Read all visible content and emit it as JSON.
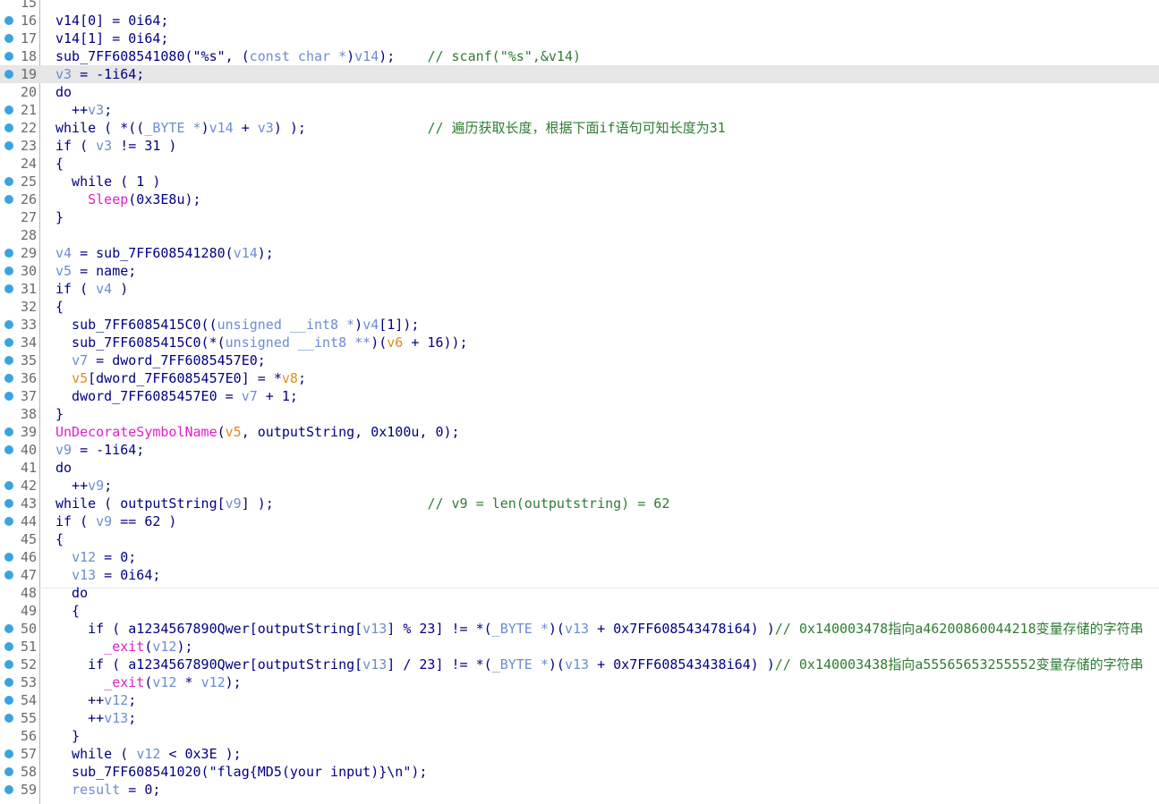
{
  "colors": {
    "default": "#000080",
    "variable": "#6b8dd1",
    "argument": "#e08a1e",
    "comment": "#2e7d32",
    "import": "#e020c8",
    "line_number": "#6a6a6a",
    "breakpoint": "#3aa3e3",
    "highlight": "#e6e6e6"
  },
  "editor": {
    "lines": [
      {
        "n": "15",
        "bp": false,
        "hl": false,
        "tokens": []
      },
      {
        "n": "16",
        "bp": true,
        "hl": false,
        "tokens": [
          [
            "d",
            "v14[0] = 0i64;"
          ]
        ]
      },
      {
        "n": "17",
        "bp": true,
        "hl": false,
        "tokens": [
          [
            "d",
            "v14[1] = 0i64;"
          ]
        ]
      },
      {
        "n": "18",
        "bp": true,
        "hl": false,
        "tokens": [
          [
            "d",
            "sub_7FF608541080(\"%s\", ("
          ],
          [
            "v",
            "const char *"
          ],
          [
            "d",
            ")"
          ],
          [
            "v",
            "v14"
          ],
          [
            "d",
            ");    "
          ],
          [
            "c",
            "// scanf(\"%s\",&v14)"
          ]
        ]
      },
      {
        "n": "19",
        "bp": true,
        "hl": true,
        "tokens": [
          [
            "v",
            "v3"
          ],
          [
            "d",
            " = -1i64;"
          ]
        ]
      },
      {
        "n": "20",
        "bp": false,
        "hl": false,
        "tokens": [
          [
            "d",
            "do"
          ]
        ]
      },
      {
        "n": "21",
        "bp": true,
        "hl": false,
        "tokens": [
          [
            "d",
            "  ++"
          ],
          [
            "v",
            "v3"
          ],
          [
            "d",
            ";"
          ]
        ]
      },
      {
        "n": "22",
        "bp": true,
        "hl": false,
        "tokens": [
          [
            "d",
            "while ( *(("
          ],
          [
            "v",
            "_BYTE *"
          ],
          [
            "d",
            ")"
          ],
          [
            "v",
            "v14"
          ],
          [
            "d",
            " + "
          ],
          [
            "v",
            "v3"
          ],
          [
            "d",
            ") );               "
          ],
          [
            "c",
            "// 遍历获取长度，根据下面if语句可知长度为31"
          ]
        ]
      },
      {
        "n": "23",
        "bp": true,
        "hl": false,
        "tokens": [
          [
            "d",
            "if ( "
          ],
          [
            "v",
            "v3"
          ],
          [
            "d",
            " != 31 )"
          ]
        ]
      },
      {
        "n": "24",
        "bp": false,
        "hl": false,
        "tokens": [
          [
            "d",
            "{"
          ]
        ]
      },
      {
        "n": "25",
        "bp": true,
        "hl": false,
        "tokens": [
          [
            "d",
            "  while ( 1 )"
          ]
        ]
      },
      {
        "n": "26",
        "bp": true,
        "hl": false,
        "tokens": [
          [
            "d",
            "    "
          ],
          [
            "f",
            "Sleep"
          ],
          [
            "d",
            "(0x3E8u);"
          ]
        ]
      },
      {
        "n": "27",
        "bp": false,
        "hl": false,
        "tokens": [
          [
            "d",
            "}"
          ]
        ]
      },
      {
        "n": "28",
        "bp": false,
        "hl": false,
        "tokens": []
      },
      {
        "n": "29",
        "bp": true,
        "hl": false,
        "tokens": [
          [
            "v",
            "v4"
          ],
          [
            "d",
            " = sub_7FF608541280("
          ],
          [
            "v",
            "v14"
          ],
          [
            "d",
            ");"
          ]
        ]
      },
      {
        "n": "30",
        "bp": true,
        "hl": false,
        "tokens": [
          [
            "v",
            "v5"
          ],
          [
            "d",
            " = name;"
          ]
        ]
      },
      {
        "n": "31",
        "bp": true,
        "hl": false,
        "tokens": [
          [
            "d",
            "if ( "
          ],
          [
            "v",
            "v4"
          ],
          [
            "d",
            " )"
          ]
        ]
      },
      {
        "n": "32",
        "bp": false,
        "hl": false,
        "tokens": [
          [
            "d",
            "{"
          ]
        ]
      },
      {
        "n": "33",
        "bp": true,
        "hl": false,
        "tokens": [
          [
            "d",
            "  sub_7FF6085415C0(("
          ],
          [
            "v",
            "unsigned __int8 *"
          ],
          [
            "d",
            ")"
          ],
          [
            "v",
            "v4"
          ],
          [
            "d",
            "[1]);"
          ]
        ]
      },
      {
        "n": "34",
        "bp": true,
        "hl": false,
        "tokens": [
          [
            "d",
            "  sub_7FF6085415C0(*("
          ],
          [
            "v",
            "unsigned __int8 **"
          ],
          [
            "d",
            ")("
          ],
          [
            "o",
            "v6"
          ],
          [
            "d",
            " + 16));"
          ]
        ]
      },
      {
        "n": "35",
        "bp": true,
        "hl": false,
        "tokens": [
          [
            "d",
            "  "
          ],
          [
            "v",
            "v7"
          ],
          [
            "d",
            " = dword_7FF6085457E0;"
          ]
        ]
      },
      {
        "n": "36",
        "bp": true,
        "hl": false,
        "tokens": [
          [
            "d",
            "  "
          ],
          [
            "o",
            "v5"
          ],
          [
            "d",
            "[dword_7FF6085457E0] = *"
          ],
          [
            "o",
            "v8"
          ],
          [
            "d",
            ";"
          ]
        ]
      },
      {
        "n": "37",
        "bp": true,
        "hl": false,
        "tokens": [
          [
            "d",
            "  dword_7FF6085457E0 = "
          ],
          [
            "v",
            "v7"
          ],
          [
            "d",
            " + 1;"
          ]
        ]
      },
      {
        "n": "38",
        "bp": false,
        "hl": false,
        "tokens": [
          [
            "d",
            "}"
          ]
        ]
      },
      {
        "n": "39",
        "bp": true,
        "hl": false,
        "tokens": [
          [
            "f",
            "UnDecorateSymbolName"
          ],
          [
            "d",
            "("
          ],
          [
            "o",
            "v5"
          ],
          [
            "d",
            ", outputString, 0x100u, 0);"
          ]
        ]
      },
      {
        "n": "40",
        "bp": true,
        "hl": false,
        "tokens": [
          [
            "v",
            "v9"
          ],
          [
            "d",
            " = -1i64;"
          ]
        ]
      },
      {
        "n": "41",
        "bp": false,
        "hl": false,
        "tokens": [
          [
            "d",
            "do"
          ]
        ]
      },
      {
        "n": "42",
        "bp": true,
        "hl": false,
        "tokens": [
          [
            "d",
            "  ++"
          ],
          [
            "v",
            "v9"
          ],
          [
            "d",
            ";"
          ]
        ]
      },
      {
        "n": "43",
        "bp": true,
        "hl": false,
        "tokens": [
          [
            "d",
            "while ( outputString["
          ],
          [
            "v",
            "v9"
          ],
          [
            "d",
            "] );                   "
          ],
          [
            "c",
            "// v9 = len(outputstring) = 62"
          ]
        ]
      },
      {
        "n": "44",
        "bp": true,
        "hl": false,
        "tokens": [
          [
            "d",
            "if ( "
          ],
          [
            "v",
            "v9"
          ],
          [
            "d",
            " == 62 )"
          ]
        ]
      },
      {
        "n": "45",
        "bp": false,
        "hl": false,
        "tokens": [
          [
            "d",
            "{"
          ]
        ]
      },
      {
        "n": "46",
        "bp": true,
        "hl": false,
        "tokens": [
          [
            "d",
            "  "
          ],
          [
            "v",
            "v12"
          ],
          [
            "d",
            " = 0;"
          ]
        ]
      },
      {
        "n": "47",
        "bp": true,
        "hl": false,
        "tokens": [
          [
            "d",
            "  "
          ],
          [
            "v",
            "v13"
          ],
          [
            "d",
            " = 0i64;"
          ]
        ]
      },
      {
        "n": "48",
        "bp": false,
        "hl": false,
        "tokens": [
          [
            "d",
            "  do"
          ]
        ]
      },
      {
        "n": "49",
        "bp": false,
        "hl": false,
        "tokens": [
          [
            "d",
            "  {"
          ]
        ]
      },
      {
        "n": "50",
        "bp": true,
        "hl": false,
        "tokens": [
          [
            "d",
            "    if ( a1234567890Qwer[outputString["
          ],
          [
            "v",
            "v13"
          ],
          [
            "d",
            "] % 23] != *("
          ],
          [
            "v",
            "_BYTE *"
          ],
          [
            "d",
            ")("
          ],
          [
            "v",
            "v13"
          ],
          [
            "d",
            " + 0x7FF608543478i64) )"
          ],
          [
            "c",
            "// 0x140003478指向a46200860044218变量存储的字符串"
          ]
        ]
      },
      {
        "n": "51",
        "bp": true,
        "hl": false,
        "tokens": [
          [
            "d",
            "      "
          ],
          [
            "f",
            "_exit"
          ],
          [
            "d",
            "("
          ],
          [
            "v",
            "v12"
          ],
          [
            "d",
            ");"
          ]
        ]
      },
      {
        "n": "52",
        "bp": true,
        "hl": false,
        "tokens": [
          [
            "d",
            "    if ( a1234567890Qwer[outputString["
          ],
          [
            "v",
            "v13"
          ],
          [
            "d",
            "] / 23] != *("
          ],
          [
            "v",
            "_BYTE *"
          ],
          [
            "d",
            ")("
          ],
          [
            "v",
            "v13"
          ],
          [
            "d",
            " + 0x7FF608543438i64) )"
          ],
          [
            "c",
            "// 0x140003438指向a55565653255552变量存储的字符串"
          ]
        ]
      },
      {
        "n": "53",
        "bp": true,
        "hl": false,
        "tokens": [
          [
            "d",
            "      "
          ],
          [
            "f",
            "_exit"
          ],
          [
            "d",
            "("
          ],
          [
            "v",
            "v12"
          ],
          [
            "d",
            " * "
          ],
          [
            "v",
            "v12"
          ],
          [
            "d",
            ");"
          ]
        ]
      },
      {
        "n": "54",
        "bp": true,
        "hl": false,
        "tokens": [
          [
            "d",
            "    ++"
          ],
          [
            "v",
            "v12"
          ],
          [
            "d",
            ";"
          ]
        ]
      },
      {
        "n": "55",
        "bp": true,
        "hl": false,
        "tokens": [
          [
            "d",
            "    ++"
          ],
          [
            "v",
            "v13"
          ],
          [
            "d",
            ";"
          ]
        ]
      },
      {
        "n": "56",
        "bp": false,
        "hl": false,
        "tokens": [
          [
            "d",
            "  }"
          ]
        ]
      },
      {
        "n": "57",
        "bp": true,
        "hl": false,
        "tokens": [
          [
            "d",
            "  while ( "
          ],
          [
            "v",
            "v12"
          ],
          [
            "d",
            " < 0x3E );"
          ]
        ]
      },
      {
        "n": "58",
        "bp": true,
        "hl": false,
        "tokens": [
          [
            "d",
            "  sub_7FF608541020(\"flag{MD5(your input)}\\n\");"
          ]
        ]
      },
      {
        "n": "59",
        "bp": true,
        "hl": false,
        "tokens": [
          [
            "d",
            "  "
          ],
          [
            "v",
            "result"
          ],
          [
            "d",
            " = 0;"
          ]
        ]
      }
    ]
  }
}
